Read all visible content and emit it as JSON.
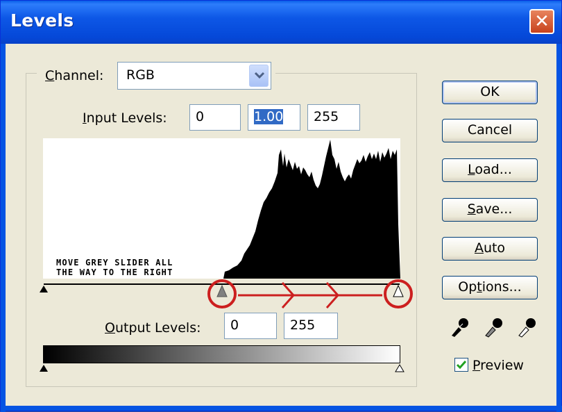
{
  "window": {
    "title": "Levels"
  },
  "channel": {
    "label": "Channel:",
    "value": "RGB"
  },
  "input_levels": {
    "label": "Input Levels:",
    "black": "0",
    "gamma": "1.00",
    "white": "255"
  },
  "annotation": {
    "line1": "MOVE GREY SLIDER ALL",
    "line2": "THE WAY TO THE RIGHT",
    "color": "#cc1f1f"
  },
  "output_levels": {
    "label": "Output Levels:",
    "black": "0",
    "white": "255"
  },
  "buttons": {
    "ok": "OK",
    "cancel": "Cancel",
    "load": "Load...",
    "save": "Save...",
    "auto": "Auto",
    "options": "Options..."
  },
  "preview": {
    "label": "Preview",
    "checked": true
  },
  "eyedroppers": [
    "black-point-eyedropper-icon",
    "gray-point-eyedropper-icon",
    "white-point-eyedropper-icon"
  ]
}
